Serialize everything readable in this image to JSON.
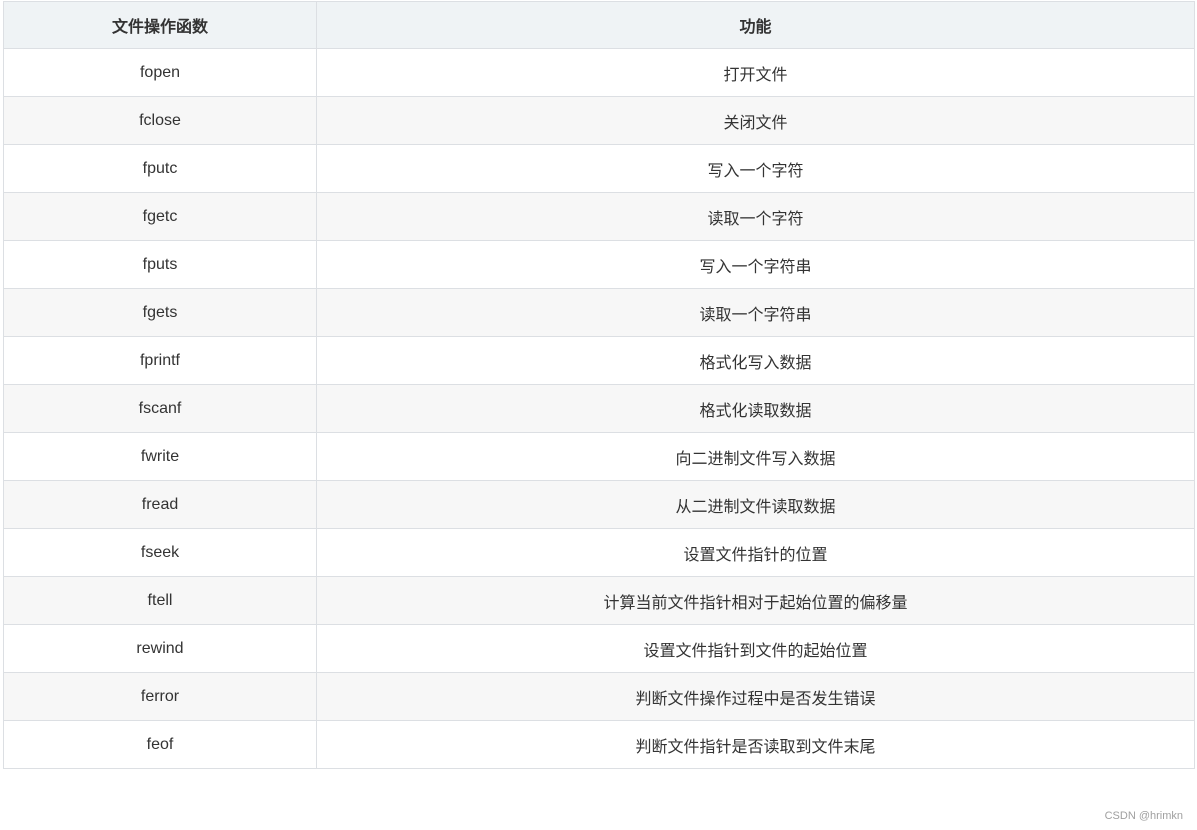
{
  "table": {
    "headers": [
      "文件操作函数",
      "功能"
    ],
    "rows": [
      {
        "fn": "fopen",
        "desc": "打开文件"
      },
      {
        "fn": "fclose",
        "desc": "关闭文件"
      },
      {
        "fn": "fputc",
        "desc": "写入一个字符"
      },
      {
        "fn": "fgetc",
        "desc": "读取一个字符"
      },
      {
        "fn": "fputs",
        "desc": "写入一个字符串"
      },
      {
        "fn": "fgets",
        "desc": "读取一个字符串"
      },
      {
        "fn": "fprintf",
        "desc": "格式化写入数据"
      },
      {
        "fn": "fscanf",
        "desc": "格式化读取数据"
      },
      {
        "fn": "fwrite",
        "desc": "向二进制文件写入数据"
      },
      {
        "fn": "fread",
        "desc": "从二进制文件读取数据"
      },
      {
        "fn": "fseek",
        "desc": "设置文件指针的位置"
      },
      {
        "fn": "ftell",
        "desc": "计算当前文件指针相对于起始位置的偏移量"
      },
      {
        "fn": "rewind",
        "desc": "设置文件指针到文件的起始位置"
      },
      {
        "fn": "ferror",
        "desc": "判断文件操作过程中是否发生错误"
      },
      {
        "fn": "feof",
        "desc": "判断文件指针是否读取到文件末尾"
      }
    ]
  },
  "watermark": "CSDN @hrimkn"
}
